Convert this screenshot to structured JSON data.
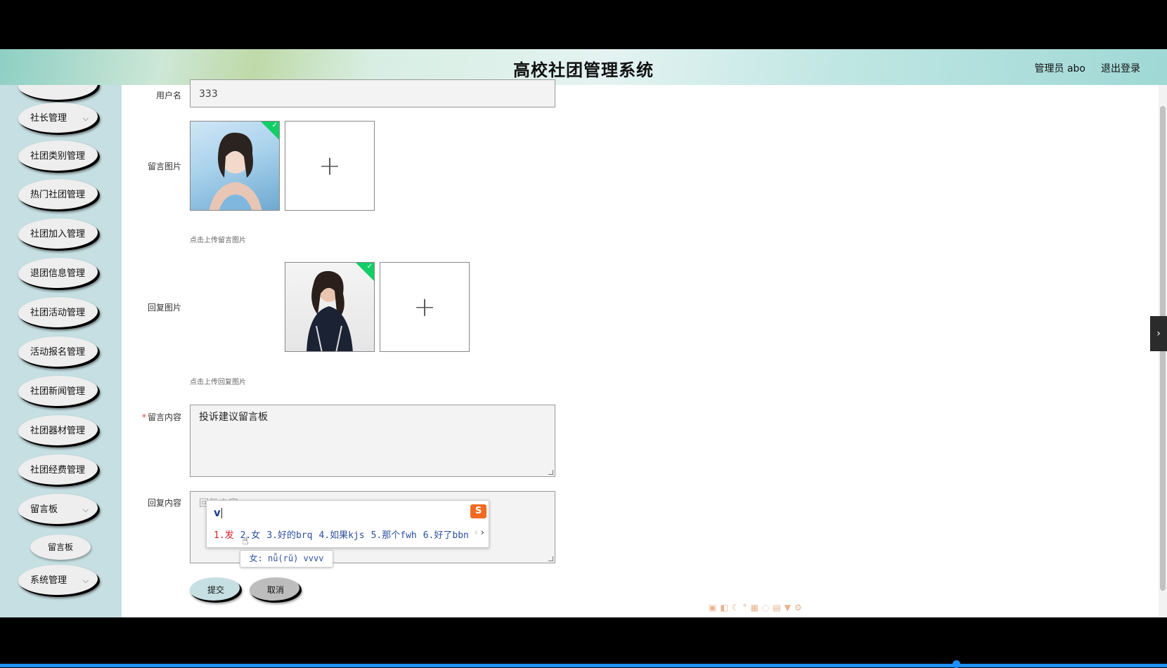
{
  "header": {
    "title": "高校社团管理系统",
    "user": "管理员 abo",
    "logout": "退出登录"
  },
  "sidebar": {
    "items": [
      {
        "label": "社长管理",
        "has_children": true
      },
      {
        "label": "社团类别管理",
        "has_children": false
      },
      {
        "label": "热门社团管理",
        "has_children": false
      },
      {
        "label": "社团加入管理",
        "has_children": false
      },
      {
        "label": "退团信息管理",
        "has_children": false
      },
      {
        "label": "社团活动管理",
        "has_children": false
      },
      {
        "label": "活动报名管理",
        "has_children": false
      },
      {
        "label": "社团新闻管理",
        "has_children": false
      },
      {
        "label": "社团器材管理",
        "has_children": false
      },
      {
        "label": "社团经费管理",
        "has_children": false
      },
      {
        "label": "留言板",
        "has_children": true
      },
      {
        "label": "系统管理",
        "has_children": true
      }
    ],
    "sub_item": "留言板"
  },
  "form": {
    "username_label": "用户名",
    "username_value": "333",
    "message_image_label": "留言图片",
    "message_image_hint": "点击上传留言图片",
    "reply_image_label": "回复图片",
    "reply_image_hint": "点击上传回复图片",
    "message_content_label": "留言内容",
    "message_content_value": "投诉建议留言板",
    "reply_content_label": "回复内容",
    "reply_content_placeholder": "回复内容",
    "submit": "提交",
    "cancel": "取消"
  },
  "ime": {
    "input": "v",
    "candidates": [
      "1.发",
      "2.女",
      "3.好的brq",
      "4.如果kjs",
      "5.那个fwh",
      "6.好了bbn"
    ],
    "tip": "女: nǚ(rǔ)  vvvv"
  },
  "colors": {
    "sidebar_bg": "#c6dfe3",
    "success_check": "#13ce66",
    "ime_logo": "#f26b21"
  }
}
